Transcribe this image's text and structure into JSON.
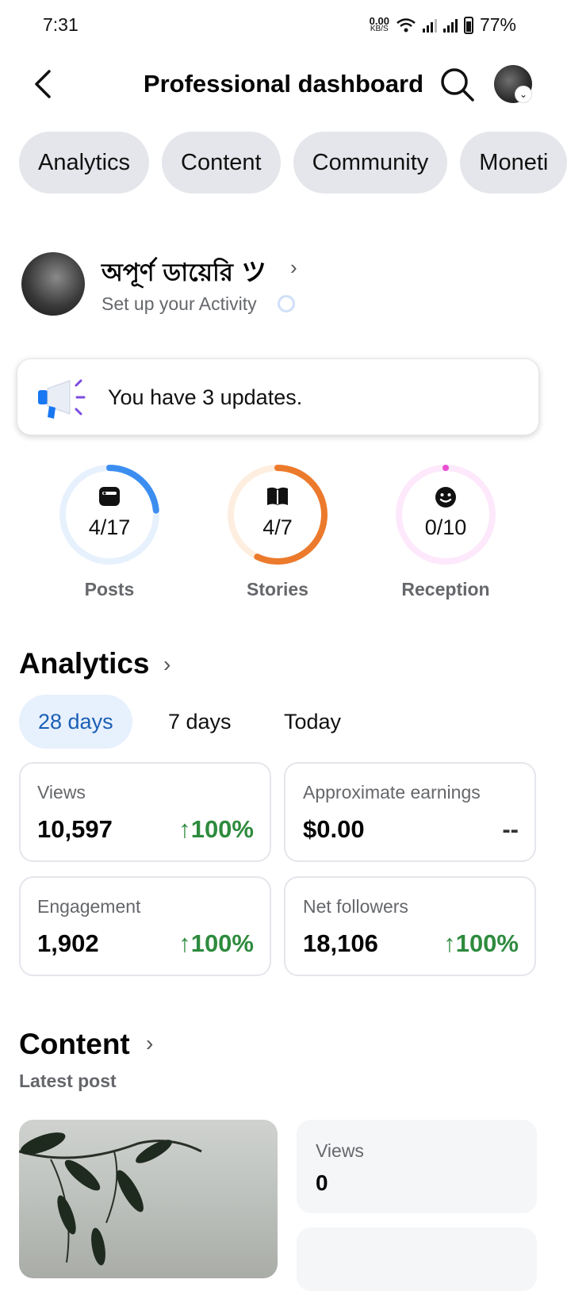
{
  "status_bar": {
    "time": "7:31",
    "net_speed": "0.00",
    "net_unit": "KB/S",
    "battery": "77%"
  },
  "header": {
    "title": "Professional dashboard"
  },
  "tabs": [
    "Analytics",
    "Content",
    "Community",
    "Moneti"
  ],
  "profile": {
    "name": "অপূর্ণ ডায়েরি ツ",
    "subtitle": "Set up your Activity"
  },
  "updates": {
    "text": "You have 3 updates."
  },
  "progress": [
    {
      "label": "Posts",
      "value": "4/17",
      "done": 4,
      "total": 17,
      "color": "#3b8ef0",
      "track": "#e7f1fd",
      "icon": "posts-icon"
    },
    {
      "label": "Stories",
      "value": "4/7",
      "done": 4,
      "total": 7,
      "color": "#ec7a2c",
      "track": "#fdeee0",
      "icon": "book-icon"
    },
    {
      "label": "Reception",
      "value": "0/10",
      "done": 0,
      "total": 10,
      "color": "#e84fd0",
      "track": "#fde9fb",
      "icon": "smiley-icon"
    }
  ],
  "analytics": {
    "title": "Analytics",
    "ranges": [
      "28 days",
      "7 days",
      "Today"
    ],
    "selected_range": "28 days",
    "metrics": [
      {
        "label": "Views",
        "value": "10,597",
        "change": "100%",
        "direction": "up"
      },
      {
        "label": "Approximate earnings",
        "value": "$0.00",
        "change": "--",
        "direction": "none"
      },
      {
        "label": "Engagement",
        "value": "1,902",
        "change": "100%",
        "direction": "up"
      },
      {
        "label": "Net followers",
        "value": "18,106",
        "change": "100%",
        "direction": "up"
      }
    ]
  },
  "content": {
    "title": "Content",
    "subtitle": "Latest post",
    "post_stats": [
      {
        "label": "Views",
        "value": "0"
      }
    ]
  },
  "colors": {
    "accent": "#1a5fb4",
    "positive": "#2e8b3e",
    "chip_bg": "#e4e6eb"
  }
}
